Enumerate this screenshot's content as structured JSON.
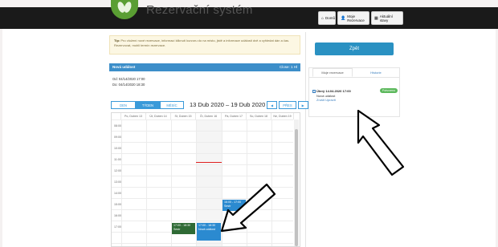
{
  "app": {
    "title": "Rezervační systém"
  },
  "topnav": {
    "items": [
      {
        "label": "Domů",
        "icon": "home-icon",
        "glyph": "⌂"
      },
      {
        "label": "Moje Rezervace",
        "icon": "user-icon",
        "glyph": "👤"
      },
      {
        "label": "Aktuální stavy",
        "icon": "calendar-icon",
        "glyph": "▦"
      }
    ]
  },
  "tip": {
    "label": "Tip:",
    "text": "Pro vložení nové rezervace, informací kliknutí kurzoru do na místo, jistě a informace události dvě a vyhledat dán a čas. Rezervovat, mohli termín rezervace.",
    "text2": "Rezervovat, mohli termín rezervace událost."
  },
  "event_panel": {
    "title": "Nová událost",
    "close_label": "Close: 1 Hl",
    "from": "Od: 04/14/2020 17:00",
    "to": "Do: 04/14/2020 18:30"
  },
  "calendar": {
    "view_buttons": [
      "DEN",
      "TÝDEN",
      "MĚSÍC"
    ],
    "active_view": "TÝDEN",
    "range": "13 Dub 2020 – 19 Dub 2020",
    "prev_label": "◀",
    "next_label": "PŘES",
    "next_arrow": "▶",
    "days": [
      "Po, Duben 13",
      "Út, Duben 14",
      "St, Duben 15",
      "Čt, Duben 16",
      "Pá, Duben 17",
      "So, Duben 18",
      "Ne, Duben 19"
    ],
    "today_index": 3,
    "times": [
      "08:00",
      "09:00",
      "10:00",
      "11:00",
      "12:00",
      "13:00",
      "14:00",
      "15:00",
      "16:00",
      "17:00"
    ],
    "events": [
      {
        "day_index": 2,
        "time": "17:00 - 18:30",
        "label": "Sestr",
        "color": "green"
      },
      {
        "day_index": 3,
        "time": "17:00 - 18:30",
        "label": "Nová událost",
        "color": "blue"
      },
      {
        "day_index": 4,
        "time": "16:00 - 17:00",
        "label": "Sestr",
        "color": "blue"
      }
    ]
  },
  "side": {
    "back_label": "Zpět",
    "tabs": [
      "Moje rezervace",
      "Historie"
    ],
    "active_tab": 0,
    "reservation": {
      "title": "Úterý 14.04.2020 17:00",
      "subtitle": "Nová událost",
      "link": "Zrušit Upravit",
      "badge": "Potvrzeno"
    }
  },
  "colors": {
    "accent": "#3a9ad9",
    "event_blue": "#2b8ad0",
    "event_green": "#2f6a35",
    "topbar": "#1a1a1a",
    "now_line": "#e02020"
  }
}
